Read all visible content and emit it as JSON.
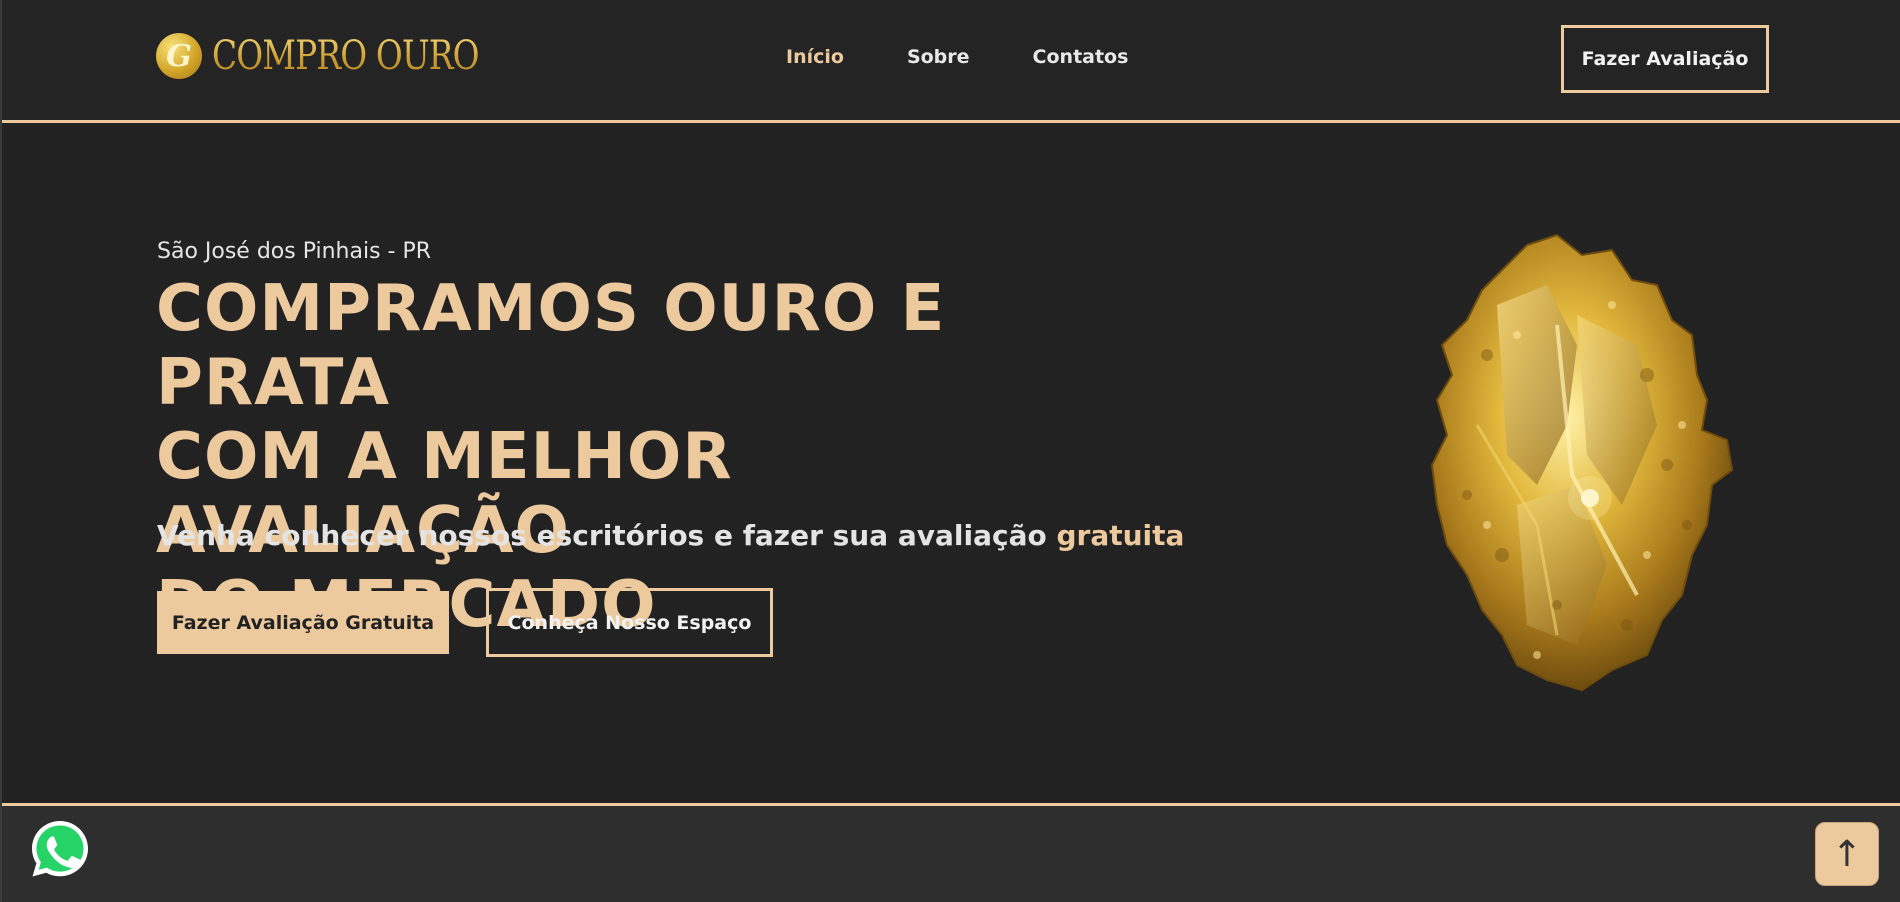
{
  "logo": {
    "letter": "G",
    "text": "COMPRO OURO"
  },
  "nav": {
    "items": [
      {
        "label": "Início",
        "active": true
      },
      {
        "label": "Sobre",
        "active": false
      },
      {
        "label": "Contatos",
        "active": false
      }
    ]
  },
  "header": {
    "cta_label": "Fazer Avaliação"
  },
  "hero": {
    "location": "São José dos Pinhais - PR",
    "headline_line1": "COMPRAMOS OURO E PRATA",
    "headline_line2": "COM A MELHOR AVALIAÇÃO",
    "headline_line3": "DO MERCADO",
    "subtitle": "Venha conhecer nossos escritórios e fazer sua avaliação",
    "subtitle_accent": "gratuita",
    "primary_button": "Fazer Avaliação Gratuita",
    "secondary_button": "Conheça Nosso Espaço",
    "image_icon": "gold-nugget"
  },
  "floating": {
    "whatsapp_icon": "whatsapp-icon",
    "scroll_top_symbol": "↑"
  },
  "colors": {
    "accent": "#edc99e",
    "background": "#222222",
    "gold": "#d4a62a"
  }
}
